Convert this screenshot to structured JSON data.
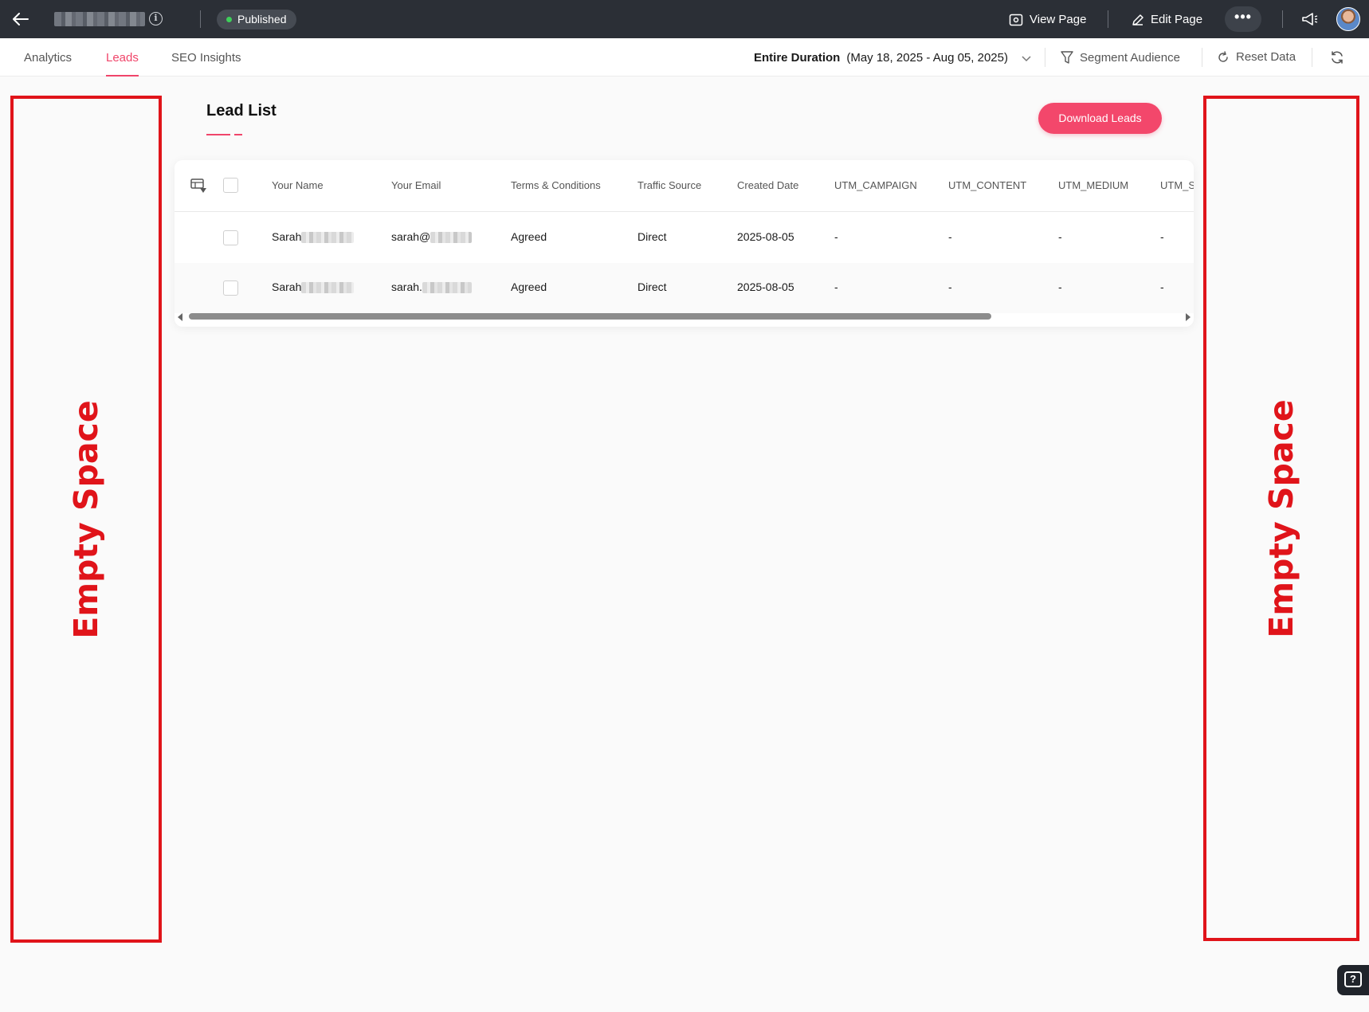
{
  "topbar": {
    "status_label": "Published",
    "view_page_label": "View Page",
    "edit_page_label": "Edit Page",
    "more_label": "•••"
  },
  "subnav": {
    "tabs": [
      {
        "label": "Analytics",
        "active": false
      },
      {
        "label": "Leads",
        "active": true
      },
      {
        "label": "SEO Insights",
        "active": false
      }
    ],
    "duration_label": "Entire Duration",
    "duration_range": "(May 18, 2025 - Aug 05, 2025)",
    "segment_label": "Segment Audience",
    "reset_label": "Reset Data"
  },
  "annotations": {
    "left_label": "Empty Space",
    "right_label": "Empty Space",
    "color": "#e0141a"
  },
  "lead_list": {
    "title": "Lead List",
    "download_label": "Download Leads",
    "columns": [
      "Your Name",
      "Your Email",
      "Terms & Conditions",
      "Traffic Source",
      "Created Date",
      "UTM_CAMPAIGN",
      "UTM_CONTENT",
      "UTM_MEDIUM",
      "UTM_S"
    ],
    "rows": [
      {
        "name": "Sarah",
        "email": "sarah@",
        "terms": "Agreed",
        "source": "Direct",
        "date": "2025-08-05",
        "utm_campaign": "-",
        "utm_content": "-",
        "utm_medium": "-",
        "utm_s": "-"
      },
      {
        "name": "Sarah",
        "email": "sarah.",
        "terms": "Agreed",
        "source": "Direct",
        "date": "2025-08-05",
        "utm_campaign": "-",
        "utm_content": "-",
        "utm_medium": "-",
        "utm_s": "-"
      }
    ]
  },
  "colors": {
    "accent": "#f0456a",
    "topbar_bg": "#2b2f36",
    "status_dot": "#3ecf5a"
  }
}
